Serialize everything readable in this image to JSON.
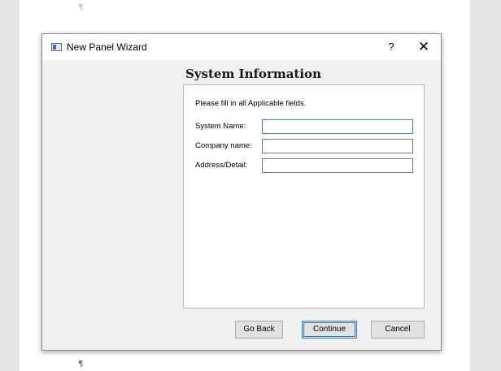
{
  "dialog": {
    "title": "New Panel Wizard",
    "help_glyph": "?",
    "close_glyph": "✕",
    "heading": "System Information",
    "instruction": "Please fill in all Applicable fields.",
    "fields": [
      {
        "label": "System Name:",
        "value": ""
      },
      {
        "label": "Company name:",
        "value": ""
      },
      {
        "label": "Address/Detail:",
        "value": ""
      }
    ],
    "buttons": {
      "back": "Go Back",
      "continue": "Continue",
      "cancel": "Cancel"
    }
  },
  "document": {
    "pilcrow": "¶"
  }
}
